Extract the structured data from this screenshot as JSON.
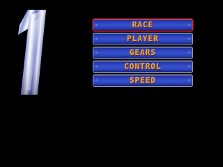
{
  "title_graphic": {
    "numeral": "1",
    "colors": {
      "chrome_light": "#f4f6ff",
      "chrome_mid": "#8c96d8",
      "chrome_dark": "#1a2266"
    }
  },
  "menu": {
    "items": [
      {
        "label": "RACE",
        "selected": true
      },
      {
        "label": "PLAYER",
        "selected": false
      },
      {
        "label": "GEARS",
        "selected": false
      },
      {
        "label": "CONTROL",
        "selected": false
      },
      {
        "label": "SPEED",
        "selected": false
      }
    ],
    "colors": {
      "button_fill": "#2a3fb8",
      "text": "#f0a040",
      "selected_border": "#e02a2a"
    }
  }
}
